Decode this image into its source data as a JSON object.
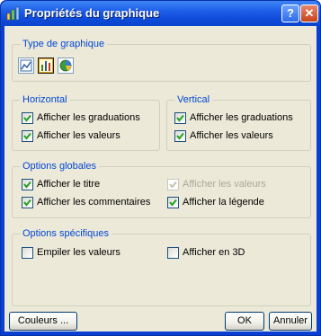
{
  "window": {
    "title": "Propriétés du graphique",
    "help_label": "?",
    "close_label": "✕"
  },
  "type_group": {
    "label": "Type de graphique",
    "buttons": [
      {
        "icon": "line-chart-icon",
        "selected": false
      },
      {
        "icon": "bar-chart-icon",
        "selected": true
      },
      {
        "icon": "pie-chart-icon",
        "selected": false
      }
    ]
  },
  "horizontal": {
    "label": "Horizontal",
    "show_ticks": {
      "label": "Afficher les graduations",
      "checked": true
    },
    "show_values": {
      "label": "Afficher les valeurs",
      "checked": true
    }
  },
  "vertical": {
    "label": "Vertical",
    "show_ticks": {
      "label": "Afficher les graduations",
      "checked": true
    },
    "show_values": {
      "label": "Afficher les valeurs",
      "checked": true
    }
  },
  "global_options": {
    "label": "Options globales",
    "show_title": {
      "label": "Afficher le titre",
      "checked": true
    },
    "show_values": {
      "label": "Afficher les valeurs",
      "checked": true,
      "disabled": true
    },
    "show_comments": {
      "label": "Afficher les commentaires",
      "checked": true
    },
    "show_legend": {
      "label": "Afficher la légende",
      "checked": true
    }
  },
  "specific_options": {
    "label": "Options spécifiques",
    "stack_values": {
      "label": "Empiler les valeurs",
      "checked": false
    },
    "show_3d": {
      "label": "Afficher en 3D",
      "checked": false
    }
  },
  "buttons": {
    "colors": "Couleurs ...",
    "ok": "OK",
    "cancel": "Annuler"
  }
}
